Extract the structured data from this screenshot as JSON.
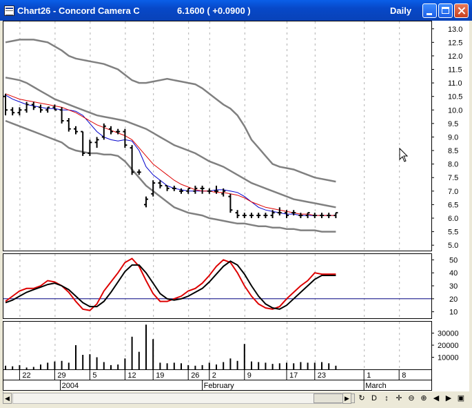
{
  "window": {
    "title": "Chart26 - Concord Camera C",
    "price_text": "6.1600 ( +0.0900 )",
    "period": "Daily"
  },
  "toolbar_icons": [
    "refresh-icon",
    "data-icon",
    "updown-icon",
    "move-icon",
    "zoom-out-icon",
    "zoom-in-icon",
    "scroll-left-icon",
    "scroll-right-icon",
    "restore-icon"
  ],
  "toolbar_glyphs": [
    "↻",
    "D",
    "↕",
    "✛",
    "⊖",
    "⊕",
    "◀",
    "▶",
    "▣"
  ],
  "chart_data": [
    {
      "type": "bar",
      "subtype": "ohlc",
      "title": "",
      "x_dates": [
        "2004-01-20",
        "2004-01-21",
        "2004-01-22",
        "2004-01-23",
        "2004-01-26",
        "2004-01-27",
        "2004-01-28",
        "2004-01-29",
        "2004-01-30",
        "2004-02-02",
        "2004-02-03",
        "2004-02-04",
        "2004-02-05",
        "2004-02-06",
        "2004-02-09",
        "2004-02-10",
        "2004-02-11",
        "2004-02-12",
        "2004-02-13",
        "2004-02-17",
        "2004-02-18",
        "2004-02-19",
        "2004-02-20",
        "2004-02-23",
        "2004-02-24",
        "2004-02-25",
        "2004-02-26",
        "2004-02-27",
        "2004-03-01",
        "2004-03-02",
        "2004-03-03",
        "2004-03-04",
        "2004-03-05",
        "2004-03-08",
        "2004-03-09",
        "2004-03-10",
        "2004-03-11",
        "2004-03-12",
        "2004-03-15",
        "2004-03-16",
        "2004-03-17",
        "2004-03-18",
        "2004-03-19",
        "2004-03-22",
        "2004-03-23",
        "2004-03-24",
        "2004-03-25",
        "2004-03-26"
      ],
      "x_tick_labels": [
        "22",
        "29",
        "5",
        "12",
        "19",
        "26",
        "2",
        "9",
        "17",
        "23",
        "1",
        "8"
      ],
      "x_group_labels": [
        "2004",
        "February",
        "March"
      ],
      "series": [
        {
          "values_ohlc": [
            [
              10.5,
              10.6,
              9.8,
              10.0
            ],
            [
              10.0,
              10.1,
              9.8,
              9.9
            ],
            [
              9.9,
              10.1,
              9.8,
              10.0
            ],
            [
              10.0,
              10.3,
              9.9,
              10.2
            ],
            [
              10.2,
              10.3,
              10.0,
              10.1
            ],
            [
              10.1,
              10.2,
              9.9,
              10.0
            ],
            [
              10.0,
              10.1,
              9.9,
              10.1
            ],
            [
              10.1,
              10.2,
              10.0,
              10.0
            ],
            [
              10.0,
              10.1,
              9.5,
              9.6
            ],
            [
              9.6,
              9.7,
              9.2,
              9.3
            ],
            [
              9.3,
              9.4,
              9.1,
              9.2
            ],
            [
              9.2,
              9.2,
              8.3,
              8.4
            ],
            [
              8.4,
              8.9,
              8.3,
              8.8
            ],
            [
              8.8,
              9.0,
              8.6,
              8.9
            ],
            [
              9.0,
              9.5,
              8.9,
              9.4
            ],
            [
              9.3,
              9.4,
              9.1,
              9.2
            ],
            [
              9.2,
              9.3,
              9.1,
              9.2
            ],
            [
              9.2,
              9.3,
              8.6,
              8.7
            ],
            [
              8.6,
              8.7,
              7.6,
              7.7
            ],
            [
              7.7,
              7.8,
              7.6,
              7.7
            ],
            [
              6.5,
              6.8,
              6.4,
              6.7
            ],
            [
              6.9,
              7.4,
              6.8,
              7.3
            ],
            [
              7.3,
              7.4,
              7.1,
              7.2
            ],
            [
              7.2,
              7.2,
              7.0,
              7.1
            ],
            [
              7.1,
              7.2,
              7.0,
              7.1
            ],
            [
              7.0,
              7.1,
              6.9,
              7.0
            ],
            [
              7.0,
              7.1,
              6.9,
              7.1
            ],
            [
              7.0,
              7.2,
              6.9,
              7.1
            ],
            [
              7.1,
              7.2,
              6.9,
              7.1
            ],
            [
              7.0,
              7.1,
              6.9,
              7.0
            ],
            [
              7.0,
              7.2,
              6.9,
              7.0
            ],
            [
              6.9,
              7.1,
              6.8,
              7.0
            ],
            [
              6.8,
              6.9,
              6.2,
              6.3
            ],
            [
              6.2,
              6.3,
              6.0,
              6.1
            ],
            [
              6.1,
              6.2,
              6.0,
              6.1
            ],
            [
              6.1,
              6.2,
              6.0,
              6.1
            ],
            [
              6.1,
              6.2,
              6.0,
              6.1
            ],
            [
              6.1,
              6.2,
              6.0,
              6.1
            ],
            [
              6.1,
              6.3,
              6.0,
              6.2
            ],
            [
              6.2,
              6.4,
              6.1,
              6.2
            ],
            [
              6.2,
              6.3,
              6.0,
              6.1
            ],
            [
              6.2,
              6.3,
              6.1,
              6.2
            ],
            [
              6.1,
              6.2,
              6.0,
              6.1
            ],
            [
              6.1,
              6.2,
              6.0,
              6.2
            ],
            [
              6.1,
              6.2,
              6.0,
              6.1
            ],
            [
              6.1,
              6.2,
              6.0,
              6.1
            ],
            [
              6.1,
              6.2,
              6.0,
              6.1
            ],
            [
              6.1,
              6.2,
              6.0,
              6.2
            ]
          ]
        },
        {
          "role": "bollinger_upper",
          "values": [
            12.5,
            12.55,
            12.6,
            12.6,
            12.6,
            12.55,
            12.5,
            12.35,
            12.2,
            12.0,
            11.9,
            11.85,
            11.8,
            11.75,
            11.7,
            11.6,
            11.5,
            11.3,
            11.1,
            11.0,
            11.0,
            11.05,
            11.1,
            11.15,
            11.1,
            11.05,
            11.0,
            10.95,
            10.8,
            10.6,
            10.4,
            10.2,
            10.05,
            9.8,
            9.4,
            8.9,
            8.6,
            8.3,
            8.0,
            7.9,
            7.85,
            7.8,
            7.7,
            7.6,
            7.5,
            7.45,
            7.4,
            7.35
          ]
        },
        {
          "role": "bollinger_middle",
          "values": [
            11.2,
            11.15,
            11.1,
            11.0,
            10.85,
            10.7,
            10.55,
            10.4,
            10.3,
            10.2,
            10.1,
            10.0,
            9.9,
            9.8,
            9.75,
            9.7,
            9.65,
            9.6,
            9.5,
            9.4,
            9.3,
            9.15,
            9.0,
            8.85,
            8.7,
            8.6,
            8.5,
            8.4,
            8.25,
            8.1,
            8.0,
            7.9,
            7.75,
            7.6,
            7.45,
            7.3,
            7.2,
            7.1,
            7.0,
            6.9,
            6.8,
            6.7,
            6.65,
            6.6,
            6.55,
            6.5,
            6.45,
            6.4
          ]
        },
        {
          "role": "bollinger_lower",
          "values": [
            9.6,
            9.5,
            9.4,
            9.3,
            9.2,
            9.1,
            9.0,
            8.9,
            8.8,
            8.6,
            8.5,
            8.45,
            8.4,
            8.4,
            8.35,
            8.35,
            8.3,
            8.1,
            7.8,
            7.5,
            7.2,
            7.0,
            6.8,
            6.6,
            6.4,
            6.3,
            6.2,
            6.15,
            6.1,
            6.0,
            5.95,
            5.9,
            5.85,
            5.8,
            5.8,
            5.75,
            5.7,
            5.7,
            5.65,
            5.65,
            5.6,
            5.6,
            5.55,
            5.55,
            5.55,
            5.5,
            5.5,
            5.5
          ]
        },
        {
          "role": "ma_fast",
          "color": "#0000cc",
          "values": [
            10.55,
            10.4,
            10.3,
            10.2,
            10.15,
            10.1,
            10.05,
            10.05,
            10.0,
            10.0,
            9.95,
            9.8,
            9.5,
            9.2,
            9.0,
            8.9,
            8.85,
            8.9,
            8.85,
            8.5,
            7.9,
            7.6,
            7.4,
            7.2,
            7.1,
            7.05,
            7.0,
            7.0,
            7.0,
            7.0,
            7.05,
            7.05,
            7.0,
            6.95,
            6.8,
            6.6,
            6.4,
            6.3,
            6.25,
            6.2,
            6.15,
            6.15,
            6.1,
            6.1,
            6.1,
            6.1,
            6.1,
            6.1
          ]
        },
        {
          "role": "ma_slow",
          "color": "#dd0000",
          "values": [
            10.6,
            10.5,
            10.4,
            10.35,
            10.3,
            10.25,
            10.2,
            10.15,
            10.1,
            10.0,
            9.9,
            9.75,
            9.6,
            9.45,
            9.35,
            9.25,
            9.15,
            9.05,
            8.9,
            8.6,
            8.3,
            8.0,
            7.8,
            7.6,
            7.4,
            7.25,
            7.15,
            7.05,
            7.0,
            7.0,
            6.95,
            6.95,
            6.9,
            6.85,
            6.75,
            6.6,
            6.5,
            6.4,
            6.35,
            6.3,
            6.25,
            6.2,
            6.15,
            6.15,
            6.1,
            6.1,
            6.1,
            6.1
          ]
        }
      ],
      "ylim": [
        4.8,
        13.3
      ],
      "y_ticks": [
        "5.0",
        "5.5",
        "6.0",
        "6.5",
        "7.0",
        "7.5",
        "8.0",
        "8.5",
        "9.0",
        "9.5",
        "10.0",
        "10.5",
        "11.0",
        "11.5",
        "12.0",
        "12.5",
        "13.0"
      ]
    },
    {
      "type": "line",
      "title": "",
      "series": [
        {
          "color": "#dd0000",
          "values": [
            18,
            22,
            26,
            28,
            28,
            30,
            34,
            33,
            30,
            25,
            18,
            12,
            11,
            16,
            26,
            33,
            40,
            48,
            51,
            45,
            34,
            24,
            18,
            18,
            20,
            22,
            26,
            28,
            32,
            38,
            45,
            50,
            48,
            40,
            30,
            22,
            16,
            13,
            12,
            14,
            20,
            25,
            30,
            34,
            40,
            39,
            39,
            39
          ]
        },
        {
          "color": "#000000",
          "values": [
            17,
            19,
            22,
            25,
            27,
            29,
            31,
            32,
            30,
            27,
            22,
            17,
            14,
            14,
            18,
            25,
            33,
            41,
            46,
            46,
            40,
            32,
            24,
            20,
            19,
            20,
            22,
            25,
            28,
            33,
            39,
            45,
            49,
            46,
            39,
            30,
            22,
            16,
            13,
            12,
            15,
            20,
            25,
            30,
            35,
            38,
            38,
            38
          ]
        }
      ],
      "reference_line": 20,
      "ylim": [
        5,
        55
      ],
      "y_ticks": [
        "10",
        "20",
        "30",
        "40",
        "50"
      ]
    },
    {
      "type": "bar",
      "title": "",
      "series": [
        {
          "values": [
            3000,
            2500,
            3500,
            1500,
            2000,
            4000,
            5500,
            6500,
            7000,
            5500,
            20000,
            12000,
            12500,
            10000,
            6000,
            3500,
            4000,
            9000,
            27000,
            14500,
            37000,
            25000,
            5500,
            5000,
            5500,
            5000,
            3500,
            3000,
            3500,
            5500,
            4000,
            6000,
            9000,
            7000,
            21000,
            6500,
            6000,
            5500,
            4500,
            5000,
            5500,
            5000,
            6000,
            5500,
            5500,
            6000,
            5000,
            3000
          ]
        }
      ],
      "ylim": [
        0,
        40000
      ],
      "y_ticks": [
        "10000",
        "20000",
        "30000"
      ]
    }
  ]
}
